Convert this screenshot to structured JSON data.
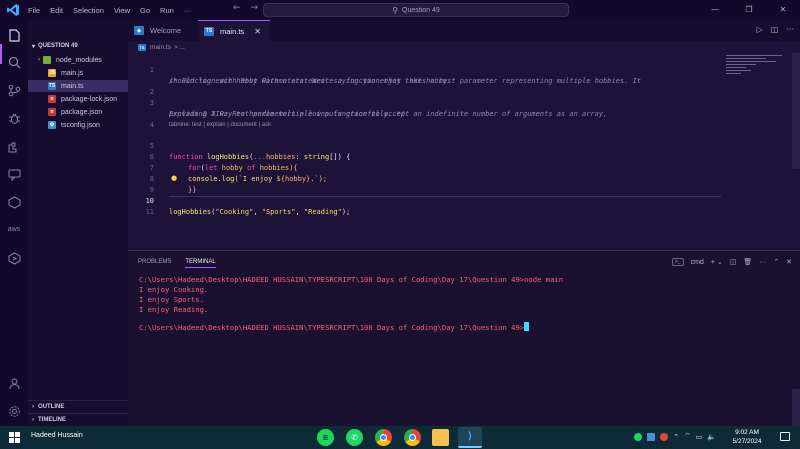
{
  "titlebar": {
    "menu": [
      "File",
      "Edit",
      "Selection",
      "View",
      "Go",
      "Run",
      "···"
    ],
    "search": "Question 49",
    "window_controls": [
      "—",
      "❐",
      "✕"
    ]
  },
  "sidebar": {
    "folder": "QUESTION 49",
    "items": [
      {
        "label": "node_modules",
        "icon": "chevron-right-icon"
      },
      {
        "label": "main.js",
        "icon": "js-file-icon"
      },
      {
        "label": "main.ts",
        "icon": "ts-file-icon"
      },
      {
        "label": "package-lock.json",
        "icon": "npm-file-icon"
      },
      {
        "label": "package.json",
        "icon": "npm-file-icon"
      },
      {
        "label": "tsconfig.json",
        "icon": "tsconfig-file-icon"
      }
    ],
    "outline": "OUTLINE",
    "timeline": "TIMELINE"
  },
  "tabs": [
    {
      "label": "Welcome"
    },
    {
      "label": "main.ts"
    }
  ],
  "breadcrumb": {
    "file": "main.ts",
    "sep": "> ..."
  },
  "editor": {
    "line_numbers": [
      "1",
      "",
      "2",
      "3",
      "",
      "4",
      "5",
      "6",
      "7",
      "8",
      "9",
      "10",
      "11"
    ],
    "comment1a": "/* Function with Rest Parameters: Write a function that takes a rest parameter representing multiple hobbies. It",
    "comment1b": "should log each hobby with a statement saying you enjoy that hobby.",
    "comment3a": "Explain & TIP: Rest parameters allow a function to accept an indefinite number of arguments as an array,",
    "comment3b": "providing a way to handle multiple inputs gracefully..*/",
    "codelens": "tabnine: test | explain | document | ask",
    "l5_kw": "function",
    "l5_fn": "logHobbies",
    "l5_p1": "(",
    "l5_spread": "...",
    "l5_param": "hobbies",
    "l5_colon": ": ",
    "l5_type": "string",
    "l5_end": "[]) {",
    "l6_for": "for",
    "l6_open": "(",
    "l6_let": "let",
    "l6_var": " hobby ",
    "l6_of": "of",
    "l6_rest": " hobbies){",
    "l7_console": "console",
    "l7_dot": ".",
    "l7_log": "log",
    "l7_open": "(`I enjoy ",
    "l7_interp": "${hobby}",
    "l7_close": ".`);",
    "l8": "}}",
    "l10_fn": "logHobbies",
    "l10_open": "(",
    "l10_a1": "\"Cooking\"",
    "l10_c1": ", ",
    "l10_a2": "\"Sports\"",
    "l10_c2": ", ",
    "l10_a3": "\"Reading\"",
    "l10_end": ");"
  },
  "panel": {
    "tabs": [
      "PROBLEMS",
      "TERMINAL"
    ],
    "shell": "cmd",
    "terminal_lines": [
      "C:\\Users\\Hadeed\\Desktop\\HADEED HUSSAIN\\TYPESRCRIPT\\100 Days of Coding\\Day 17\\Question 49>node main",
      "I enjoy Cooking.",
      "I enjoy Sports.",
      "I enjoy Reading.",
      "",
      "C:\\Users\\Hadeed\\Desktop\\HADEED HUSSAIN\\TYPESRCRIPT\\100 Days of Coding\\Day 17\\Question 49>"
    ]
  },
  "taskbar": {
    "user": "Hadeed Hussain",
    "time": "9:02 AM",
    "date": "5/27/2024"
  },
  "colors": {
    "accent": "#b05cff",
    "terminal_text": "#ff5c7a",
    "taskbar": "#0e2a36"
  }
}
